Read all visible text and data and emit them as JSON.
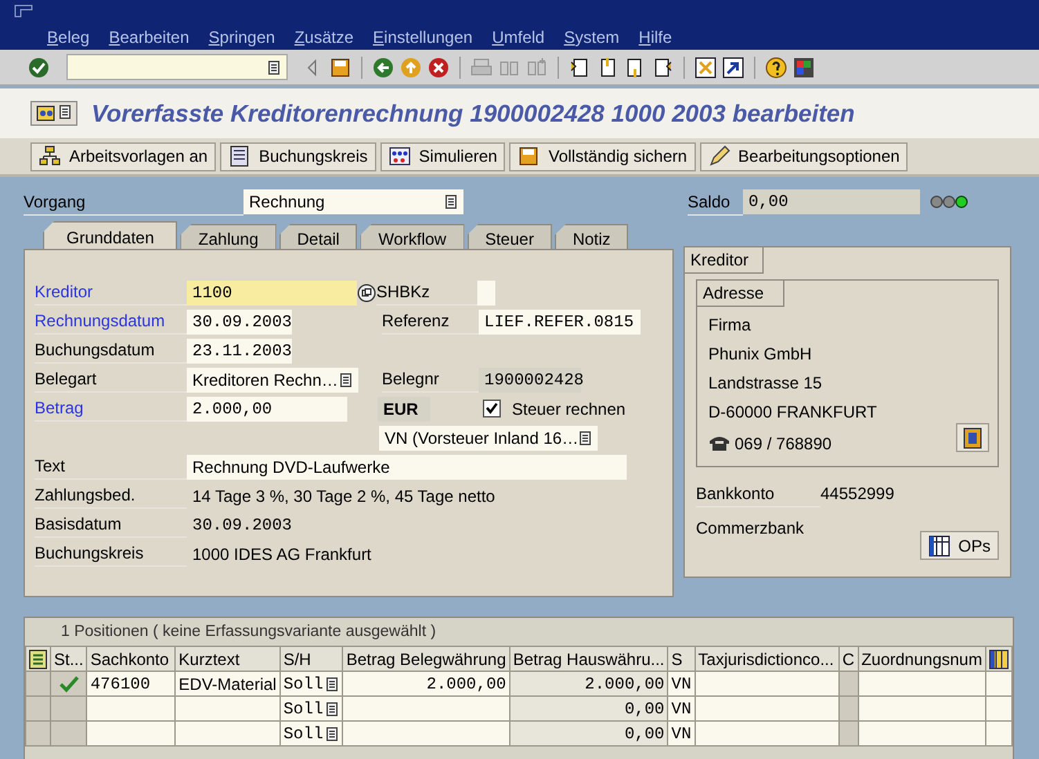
{
  "menu": [
    {
      "label": "Beleg"
    },
    {
      "label": "Bearbeiten"
    },
    {
      "label": "Springen"
    },
    {
      "label": "Zusätze"
    },
    {
      "label": "Einstellungen"
    },
    {
      "label": "Umfeld"
    },
    {
      "label": "System"
    },
    {
      "label": "Hilfe"
    }
  ],
  "title": "Vorerfasste Kreditorenrechnung 1900002428 1000 2003 bearbeiten",
  "app_toolbar": [
    {
      "label": "Arbeitsvorlagen an"
    },
    {
      "label": "Buchungskreis"
    },
    {
      "label": "Simulieren"
    },
    {
      "label": "Vollständig sichern"
    },
    {
      "label": "Bearbeitungsoptionen"
    }
  ],
  "vorgang": {
    "label": "Vorgang",
    "value": "Rechnung"
  },
  "saldo": {
    "label": "Saldo",
    "value": "0,00"
  },
  "tabs": [
    {
      "label": "Grunddaten",
      "selected": true
    },
    {
      "label": "Zahlung",
      "selected": false
    },
    {
      "label": "Detail",
      "selected": false
    },
    {
      "label": "Workflow",
      "selected": false
    },
    {
      "label": "Steuer",
      "selected": false
    },
    {
      "label": "Notiz",
      "selected": false
    }
  ],
  "grunddaten": {
    "kreditor": {
      "label": "Kreditor",
      "value": "1100",
      "required": true
    },
    "shbkz": {
      "label": "SHBKz"
    },
    "rechnungsdatum": {
      "label": "Rechnungsdatum",
      "value": "30.09.2003",
      "required": true
    },
    "referenz": {
      "label": "Referenz",
      "value": "LIEF.REFER.0815"
    },
    "buchungsdatum": {
      "label": "Buchungsdatum",
      "value": "23.11.2003",
      "required": false
    },
    "belegart": {
      "label": "Belegart",
      "value": "Kreditoren Rechn…",
      "required": false
    },
    "belegnr": {
      "label": "Belegnr",
      "value": "1900002428"
    },
    "betrag": {
      "label": "Betrag",
      "value": "2.000,00",
      "required": true
    },
    "waehrung": "EUR",
    "steuer_rechnen": {
      "label": "Steuer rechnen",
      "checked": true
    },
    "steuerkennzeichen": "VN (Vorsteuer Inland 16…",
    "text": {
      "label": "Text",
      "value": "Rechnung DVD-Laufwerke",
      "required": false
    },
    "zahlungsbed": {
      "label": "Zahlungsbed.",
      "value": "14 Tage 3 %, 30 Tage 2 %, 45 Tage netto"
    },
    "basisdatum": {
      "label": "Basisdatum",
      "value": "30.09.2003"
    },
    "buchungskreis": {
      "label": "Buchungskreis",
      "value": "1000 IDES AG Frankfurt"
    }
  },
  "kreditor_panel": {
    "title": "Kreditor",
    "address_title": "Adresse",
    "address_lines": [
      "Firma",
      "Phunix GmbH",
      "Landstrasse 15",
      "D-60000 FRANKFURT"
    ],
    "phone": "069 / 768890",
    "bank_label": "Bankkonto",
    "bank_account": "44552999",
    "bank_name": "Commerzbank",
    "ops_button": "OPs"
  },
  "positions": {
    "title": "1 Positionen ( keine Erfassungsvariante ausgewählt )",
    "columns": [
      "St...",
      "Sachkonto",
      "Kurztext",
      "S/H",
      "Betrag Belegwährung",
      "Betrag Hauswähru...",
      "S",
      "Taxjurisdictionco...",
      "C",
      "Zuordnungsnum"
    ],
    "rows": [
      {
        "ok": true,
        "sachkonto": "476100",
        "kurztext": "EDV-Material",
        "sh": "Soll",
        "betrag_beleg": "2.000,00",
        "betrag_haus": "2.000,00",
        "s": "VN"
      },
      {
        "ok": false,
        "sh": "Soll",
        "betrag_haus": "0,00",
        "s": "VN"
      },
      {
        "ok": false,
        "sh": "Soll",
        "betrag_haus": "0,00",
        "s": "VN"
      }
    ]
  }
}
